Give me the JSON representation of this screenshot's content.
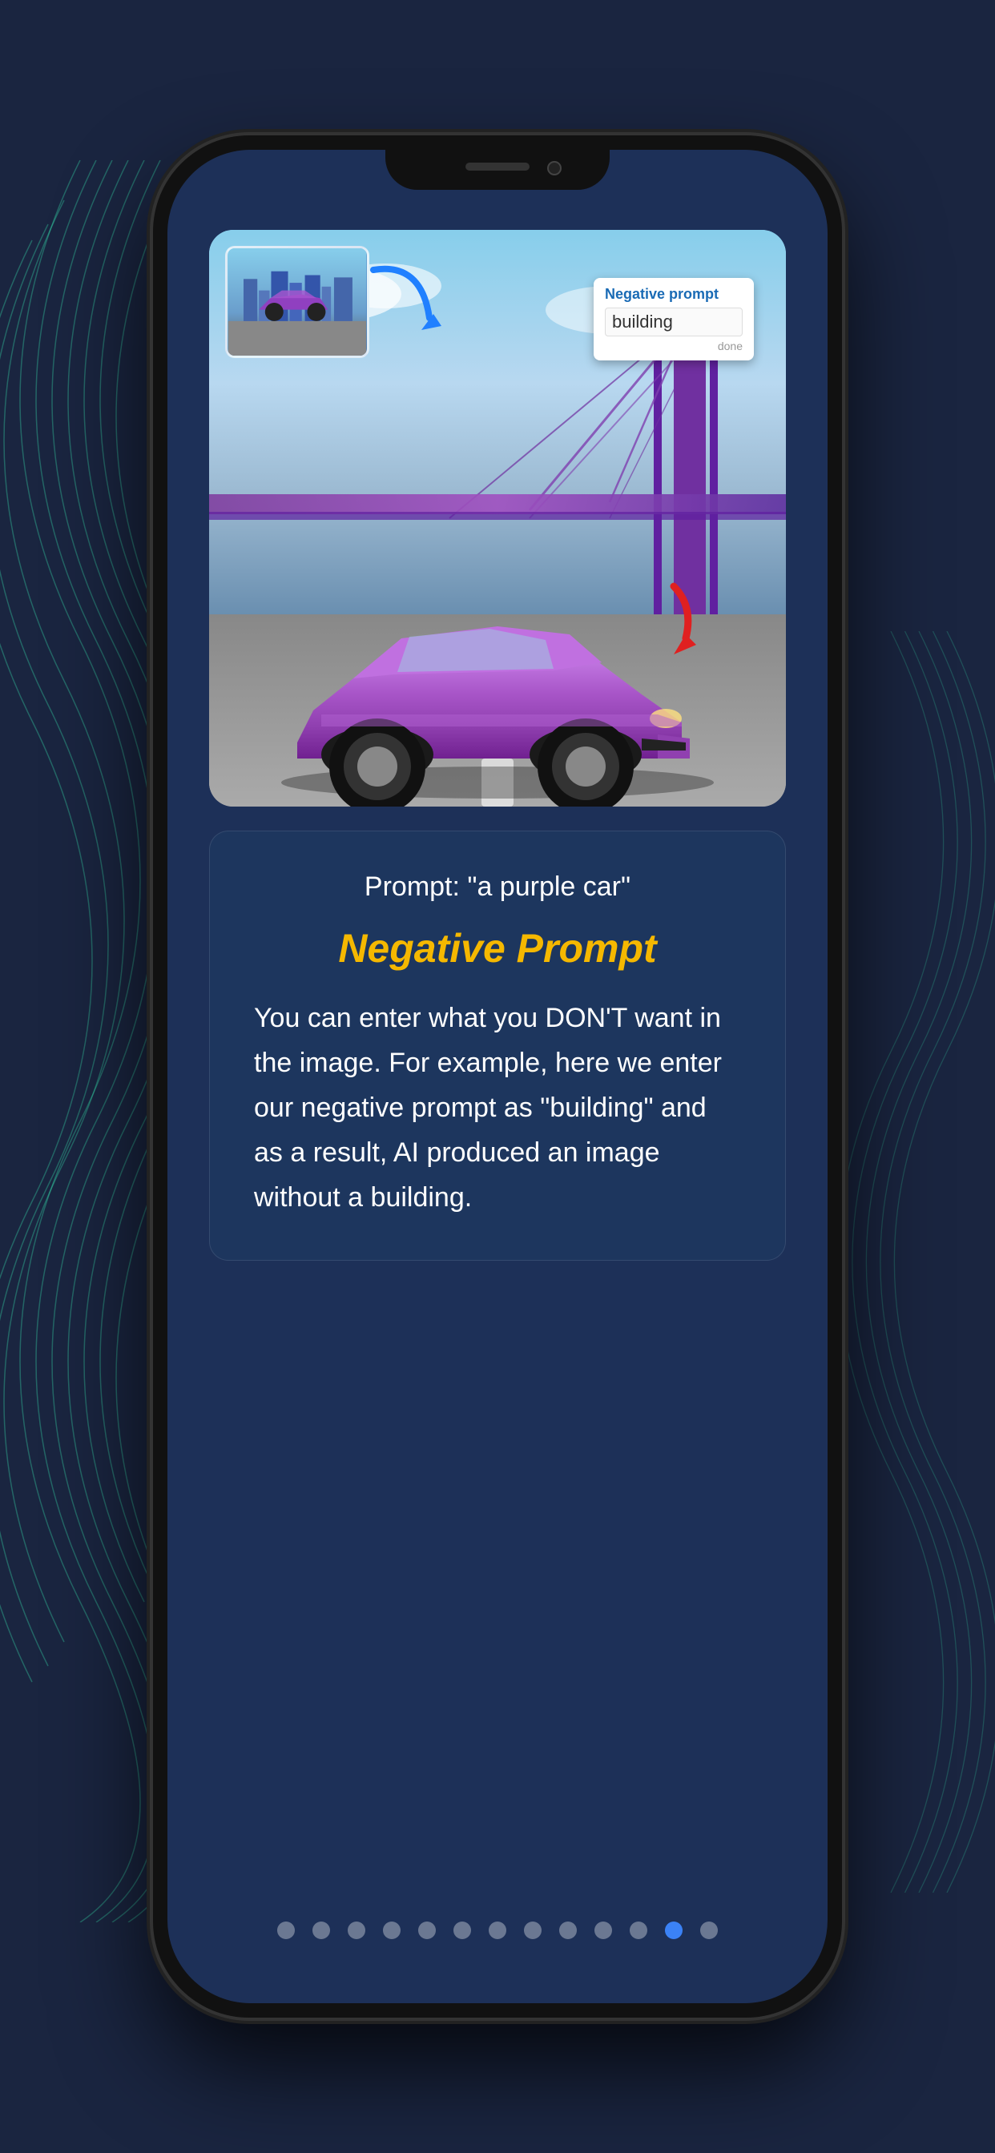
{
  "background": {
    "color": "#1a2540"
  },
  "phone": {
    "frame_color": "#111"
  },
  "screen": {
    "background": "#1d3058"
  },
  "image_section": {
    "alt": "Purple sports car in front of a purple bridge"
  },
  "thumbnail": {
    "alt": "Small purple car with city buildings thumbnail"
  },
  "negative_prompt_popup": {
    "label": "Negative prompt",
    "value": "building",
    "sublabel": "done"
  },
  "text_card": {
    "prompt_line": "Prompt: \"a purple car\"",
    "section_title": "Negative Prompt",
    "description": "You can enter what you DON'T want in the image. For example, here we enter our negative prompt as \"building\" and as a result, AI produced an image without a building."
  },
  "dots": {
    "total": 13,
    "active_index": 11
  }
}
